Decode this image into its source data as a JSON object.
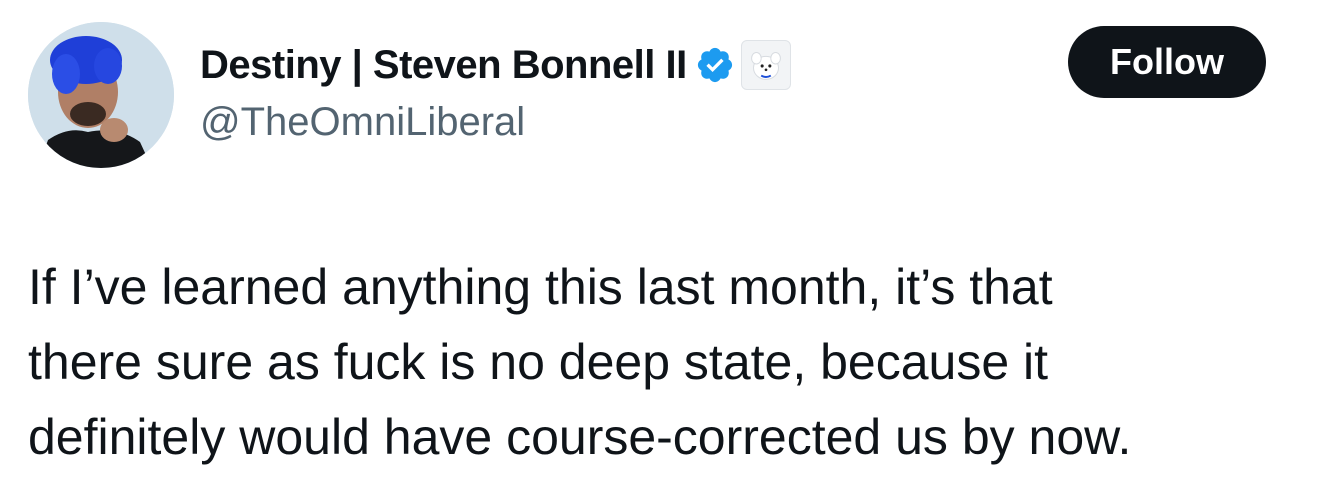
{
  "author": {
    "display_name": "Destiny | Steven Bonnell II",
    "handle": "@TheOmniLiberal",
    "verified": true,
    "avatar_icon": "profile-photo-blue-hair",
    "affiliate_badge_icon": "dog-badge-icon"
  },
  "follow_button": {
    "label": "Follow"
  },
  "tweet": {
    "lines": [
      "If I’ve learned anything this last month, it’s that",
      "there sure as fuck is no deep state, because it",
      "definitely would have course-corrected us by now."
    ]
  },
  "colors": {
    "text_primary": "#0f1419",
    "text_secondary": "#536471",
    "verified_blue": "#1d9bf0",
    "button_bg": "#0f1419",
    "button_text": "#ffffff",
    "background": "#ffffff"
  }
}
